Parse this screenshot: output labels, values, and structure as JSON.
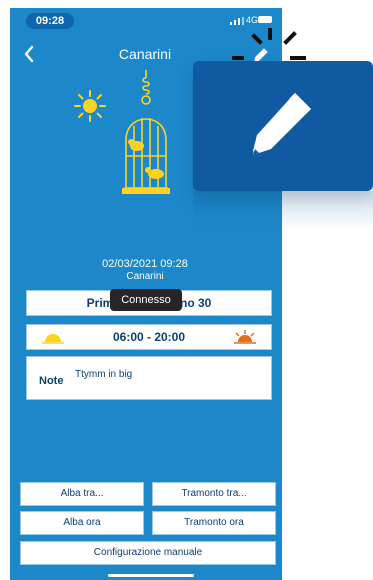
{
  "status": {
    "time": "09:28",
    "network": "4G"
  },
  "nav": {
    "title": "Canarini"
  },
  "info": {
    "datetime": "02/03/2021 09:28",
    "subtitle": "Canarini"
  },
  "program": {
    "label": "Primavera - Giorno 30"
  },
  "toast": {
    "text": "Connesso"
  },
  "hours": {
    "text": "06:00  -  20:00"
  },
  "note": {
    "label": "Note",
    "text": "Ttymm in big"
  },
  "buttons": {
    "alba_tra": "Alba tra...",
    "tramonto_tra": "Tramonto tra...",
    "alba_ora": "Alba ora",
    "tramonto_ora": "Tramonto ora",
    "manual": "Configurazione manuale"
  },
  "icons": {
    "back": "chevron-left-icon",
    "edit": "pencil-icon",
    "sun": "sun-icon",
    "cage": "birdcage-icon",
    "sunrise": "sunrise-icon",
    "sunset": "sunset-icon"
  },
  "colors": {
    "background": "#1c88c9",
    "callout": "#0f5aa1",
    "accent": "#ffd21f",
    "text_dark": "#0e3f73"
  }
}
